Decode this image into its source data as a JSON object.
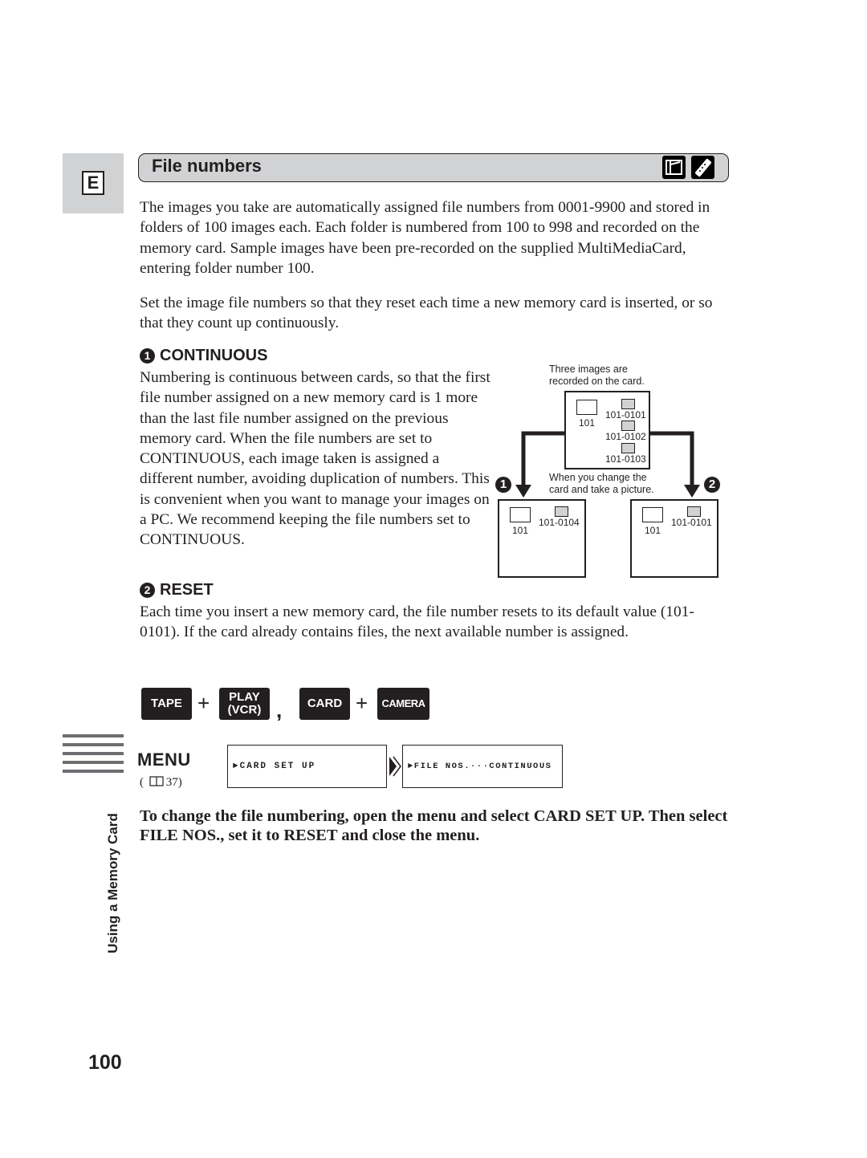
{
  "language_tab": "E",
  "section": {
    "title": "File numbers",
    "mode_icons": [
      "card-camera-icon",
      "remote-control-icon"
    ]
  },
  "intro": {
    "p1": "The images you take are automatically assigned file numbers from 0001-9900 and stored in folders of 100 images each. Each folder is numbered from 100 to 998 and recorded on the memory card. Sample images have been pre-recorded on the supplied MultiMediaCard, entering folder number 100.",
    "p2": "Set the image file numbers so that they reset each time a new memory card is inserted, or so that they count up continuously."
  },
  "continuous": {
    "number": "1",
    "heading": "CONTINUOUS",
    "text": "Numbering is continuous between cards, so that the first file number assigned on a new memory card is 1 more than the last file number assigned on the previous memory card. When the file numbers are set to CONTINUOUS, each image taken is assigned a different number, avoiding duplication of numbers. This is convenient when you want to manage your images on a PC. We recommend keeping the file numbers set to CONTINUOUS."
  },
  "reset": {
    "number": "2",
    "heading": "RESET",
    "text": "Each time you insert a new memory card, the file number resets to its default value (101-0101). If the card already contains files, the next available number is assigned."
  },
  "diagram": {
    "top_caption_1": "Three images are",
    "top_caption_2": "recorded on the card.",
    "mid_caption_1": "When you change the",
    "mid_caption_2": "card and take a picture.",
    "source_card": {
      "folder": "101",
      "files": [
        "101-0101",
        "101-0102",
        "101-0103"
      ]
    },
    "continuous_card": {
      "marker": "1",
      "folder": "101",
      "files": [
        "101-0104"
      ]
    },
    "reset_card": {
      "marker": "2",
      "folder": "101",
      "files": [
        "101-0101"
      ]
    }
  },
  "mode_keys": {
    "tape": "TAPE",
    "play_1": "PLAY",
    "play_2": "(VCR)",
    "separator": ",",
    "card": "CARD",
    "camera": "CAMERA",
    "plus": "+"
  },
  "menu": {
    "label": "MENU",
    "ref_open": "(",
    "ref_page": "37)",
    "screen1": "►CARD SET UP",
    "screen2": "►FILE NOS.···CONTINUOUS"
  },
  "instruction": "To change the file numbering, open the menu and select CARD SET UP. Then select FILE NOS., set it to RESET and close the menu.",
  "side_label": "Using a Memory Card",
  "page_number": "100"
}
